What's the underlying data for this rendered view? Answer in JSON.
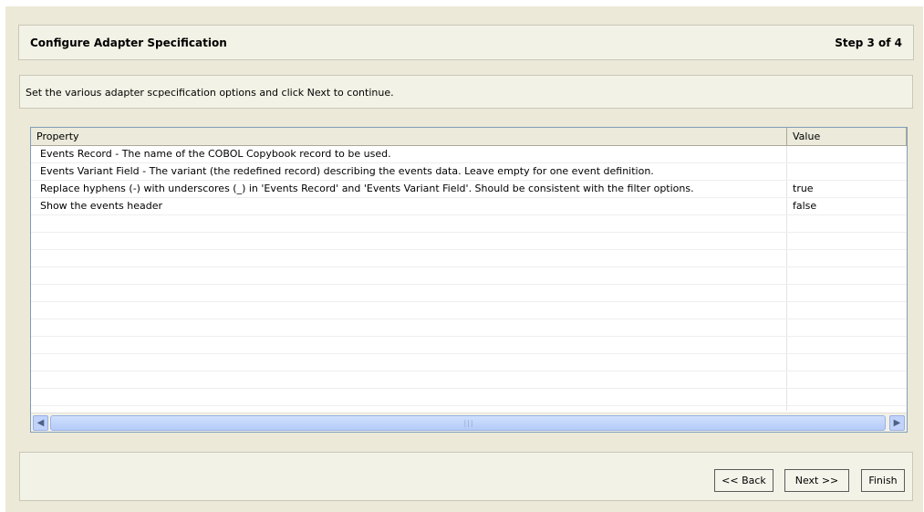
{
  "header": {
    "title": "Configure Adapter Specification",
    "step": "Step 3 of 4"
  },
  "description": "Set the various adapter scpecification options and click Next to continue.",
  "table": {
    "columns": [
      "Property",
      "Value"
    ],
    "rows": [
      {
        "property": "Events Record - The name of the COBOL Copybook record to be used.",
        "value": ""
      },
      {
        "property": "Events Variant Field - The variant (the redefined record) describing the events data. Leave empty for one event definition.",
        "value": ""
      },
      {
        "property": "Replace hyphens (-) with underscores (_) in 'Events Record' and 'Events Variant Field'. Should be consistent with the filter options.",
        "value": "true"
      },
      {
        "property": "Show the events header",
        "value": "false"
      }
    ],
    "empty_row_count": 11
  },
  "icons": {
    "scroll_left": "scroll-left-arrow-icon",
    "scroll_right": "scroll-right-arrow-icon"
  },
  "buttons": {
    "back": "<< Back",
    "next": "Next >>",
    "finish": "Finish"
  }
}
